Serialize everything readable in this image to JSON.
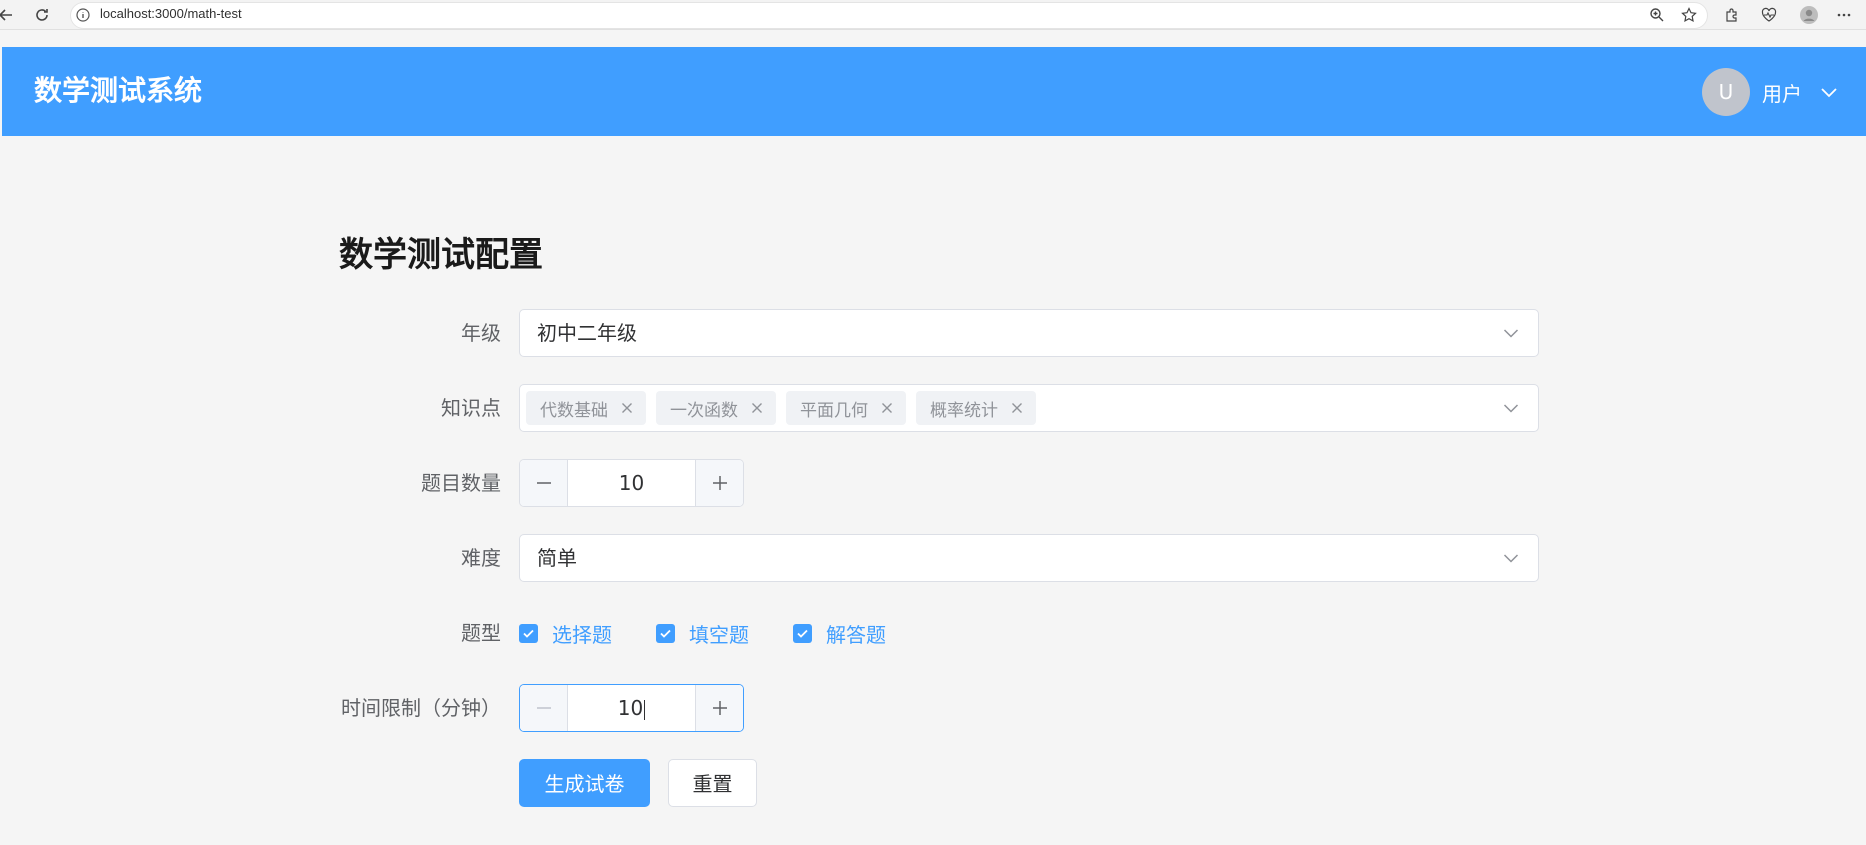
{
  "browser": {
    "url": "localhost:3000/math-test"
  },
  "header": {
    "title": "数学测试系统",
    "avatar_letter": "U",
    "user_name": "用户"
  },
  "form": {
    "title": "数学测试配置",
    "grade": {
      "label": "年级",
      "value": "初中二年级"
    },
    "knowledge": {
      "label": "知识点",
      "tags": [
        "代数基础",
        "一次函数",
        "平面几何",
        "概率统计"
      ]
    },
    "question_count": {
      "label": "题目数量",
      "value": "10"
    },
    "difficulty": {
      "label": "难度",
      "value": "简单"
    },
    "question_types": {
      "label": "题型",
      "options": [
        "选择题",
        "填空题",
        "解答题"
      ]
    },
    "time_limit": {
      "label": "时间限制（分钟）",
      "value": "10"
    },
    "buttons": {
      "generate": "生成试卷",
      "reset": "重置"
    }
  },
  "colors": {
    "primary": "#409eff",
    "background": "#f5f5f5"
  }
}
